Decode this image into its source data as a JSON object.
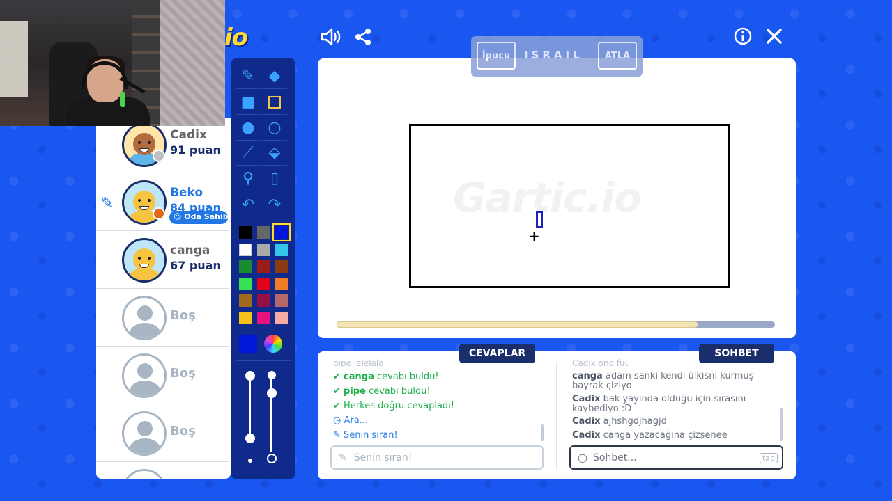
{
  "logo_text": "io",
  "header": {
    "sound_icon": "speaker-icon",
    "share_icon": "share-icon",
    "info_icon": "info-icon",
    "close_icon": "close-icon"
  },
  "word_bar": {
    "hint_label": "İpucu",
    "word": "ISRAIL",
    "skip_label": "ATLA"
  },
  "players": [
    {
      "name": "Cadix",
      "score": "91 puan",
      "status_color": "#c0c0c0"
    },
    {
      "name": "Beko",
      "score": "84 puan",
      "status_color": "#e06a1a",
      "badge": "Oda Sahibi"
    },
    {
      "name": "canga",
      "score": "67 puan"
    },
    {
      "name": "Boş"
    },
    {
      "name": "Boş"
    },
    {
      "name": "Boş"
    }
  ],
  "canvas": {
    "watermark": "Gartic.io",
    "progress_fraction": 0.825
  },
  "answers": {
    "tab_label": "CEVAPLAR",
    "cut_top": "pipe lelelala",
    "messages": [
      {
        "user": "canga",
        "text": "cevabı buldu!"
      },
      {
        "user": "pipe",
        "text": "cevabı buldu!"
      },
      {
        "text": "Herkes doğru cevapladı!"
      },
      {
        "text": "Ara..."
      },
      {
        "text": "Senin sıran!"
      }
    ],
    "input_placeholder": "Senin sıran!"
  },
  "chat": {
    "tab_label": "SOHBET",
    "cut_top": "Cadix ono fuu",
    "messages": [
      {
        "user": "canga",
        "text": "adam sanki kendi ülkisni kurmuş bayrak çiziyo"
      },
      {
        "user": "Cadix",
        "text": "bak yayında olduğu için sırasını kaybediyo :D"
      },
      {
        "user": "Cadix",
        "text": "ajhshgdjhagjd"
      },
      {
        "user": "Cadix",
        "text": "canga yazacağına çizsenee"
      }
    ],
    "input_placeholder": "Sohbet...",
    "tab_key": "tab"
  },
  "palette": [
    "#000000",
    "#666666",
    "#0016d9",
    "#ffffff",
    "#aaaaaa",
    "#34c6ea",
    "#1a8c2f",
    "#9c1b1b",
    "#8a3b10",
    "#37e055",
    "#e2001a",
    "#f07c25",
    "#a26a1c",
    "#950e45",
    "#b5676b",
    "#f5c21b",
    "#e7127d",
    "#f7a9a3"
  ],
  "current_color": "#0016d9"
}
